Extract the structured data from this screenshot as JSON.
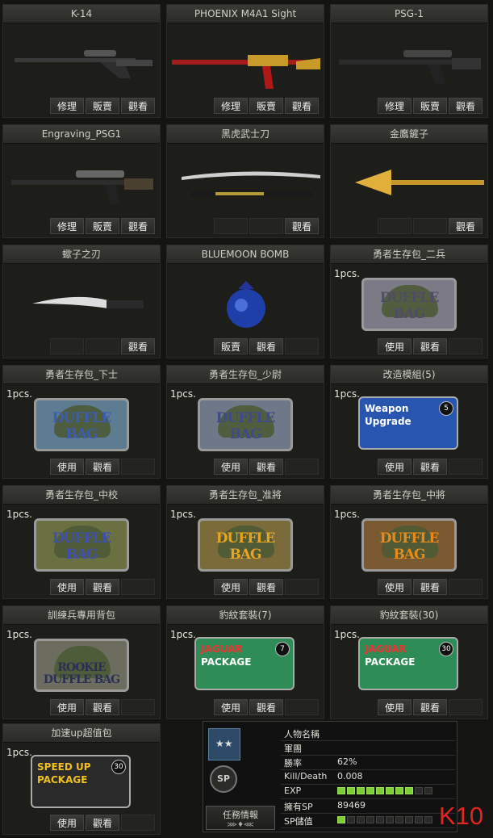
{
  "items": [
    {
      "title": "K-14",
      "buttons": [
        "修理",
        "販賣",
        "觀看"
      ]
    },
    {
      "title": "PHOENIX M4A1 Sight",
      "buttons": [
        "修理",
        "販賣",
        "觀看"
      ]
    },
    {
      "title": "PSG-1",
      "buttons": [
        "修理",
        "販賣",
        "觀看"
      ]
    },
    {
      "title": "Engraving_PSG1",
      "buttons": [
        "修理",
        "販賣",
        "觀看"
      ]
    },
    {
      "title": "黑虎武士刀",
      "buttons": [
        "",
        "",
        "觀看"
      ]
    },
    {
      "title": "金鷹鏟子",
      "buttons": [
        "",
        "",
        "觀看"
      ]
    },
    {
      "title": "蠍子之刃",
      "buttons": [
        "",
        "",
        "觀看"
      ]
    },
    {
      "title": "BLUEMOON BOMB",
      "buttons": [
        "販賣",
        "觀看",
        ""
      ]
    },
    {
      "title": "勇者生存包_二兵",
      "qty": "1pcs.",
      "bag_text": "DUFFLE BAG",
      "buttons": [
        "使用",
        "觀看",
        ""
      ]
    },
    {
      "title": "勇者生存包_下士",
      "qty": "1pcs.",
      "bag_text": "DUFFLE BAG",
      "buttons": [
        "使用",
        "觀看",
        ""
      ]
    },
    {
      "title": "勇者生存包_少尉",
      "qty": "1pcs.",
      "bag_text": "DUFFLE BAG",
      "buttons": [
        "使用",
        "觀看",
        ""
      ]
    },
    {
      "title": "改造模組(5)",
      "qty": "1pcs.",
      "pkg_text1": "Weapon",
      "pkg_text2": "Upgrade",
      "badge": "5",
      "buttons": [
        "使用",
        "觀看",
        ""
      ]
    },
    {
      "title": "勇者生存包_中校",
      "qty": "1pcs.",
      "bag_text": "DUFFLE BAG",
      "buttons": [
        "使用",
        "觀看",
        ""
      ]
    },
    {
      "title": "勇者生存包_准將",
      "qty": "1pcs.",
      "bag_text": "DUFFLE BAG",
      "buttons": [
        "使用",
        "觀看",
        ""
      ]
    },
    {
      "title": "勇者生存包_中將",
      "qty": "1pcs.",
      "bag_text": "DUFFLE BAG",
      "buttons": [
        "使用",
        "觀看",
        ""
      ]
    },
    {
      "title": "訓練兵專用背包",
      "qty": "1pcs.",
      "bag_text": "ROOKIE DUFFLE BAG",
      "buttons": [
        "使用",
        "觀看",
        ""
      ]
    },
    {
      "title": "豹紋套裝(7)",
      "qty": "1pcs.",
      "pkg_text1": "JAGUAR",
      "pkg_text2": "PACKAGE",
      "badge": "7",
      "buttons": [
        "使用",
        "觀看",
        ""
      ]
    },
    {
      "title": "豹紋套裝(30)",
      "qty": "1pcs.",
      "pkg_text1": "JAGUAR",
      "pkg_text2": "PACKAGE",
      "badge": "30",
      "buttons": [
        "使用",
        "觀看",
        ""
      ]
    },
    {
      "title": "加速up超值包",
      "qty": "1pcs.",
      "pkg_text1": "SPEED UP",
      "pkg_text2": "PACKAGE",
      "badge": "30",
      "buttons": [
        "使用",
        "觀看",
        ""
      ]
    }
  ],
  "status": {
    "mission_button": "任務情報",
    "sp_emblem": "SP",
    "rows": [
      {
        "key": "人物名稱",
        "value": ""
      },
      {
        "key": "軍團",
        "value": ""
      },
      {
        "key": "勝率",
        "value": "62%"
      },
      {
        "key": "Kill/Death",
        "value": "0.008"
      },
      {
        "key": "EXP",
        "value": "",
        "bar_fill": 0.8
      },
      {
        "key": "擁有SP",
        "value": "89469"
      },
      {
        "key": "SP儲值",
        "value": "",
        "bar_fill": 0.1
      }
    ]
  },
  "watermark": "K10",
  "colors": {
    "accent_red": "#e0261f",
    "exp_green": "#7ccd36"
  }
}
